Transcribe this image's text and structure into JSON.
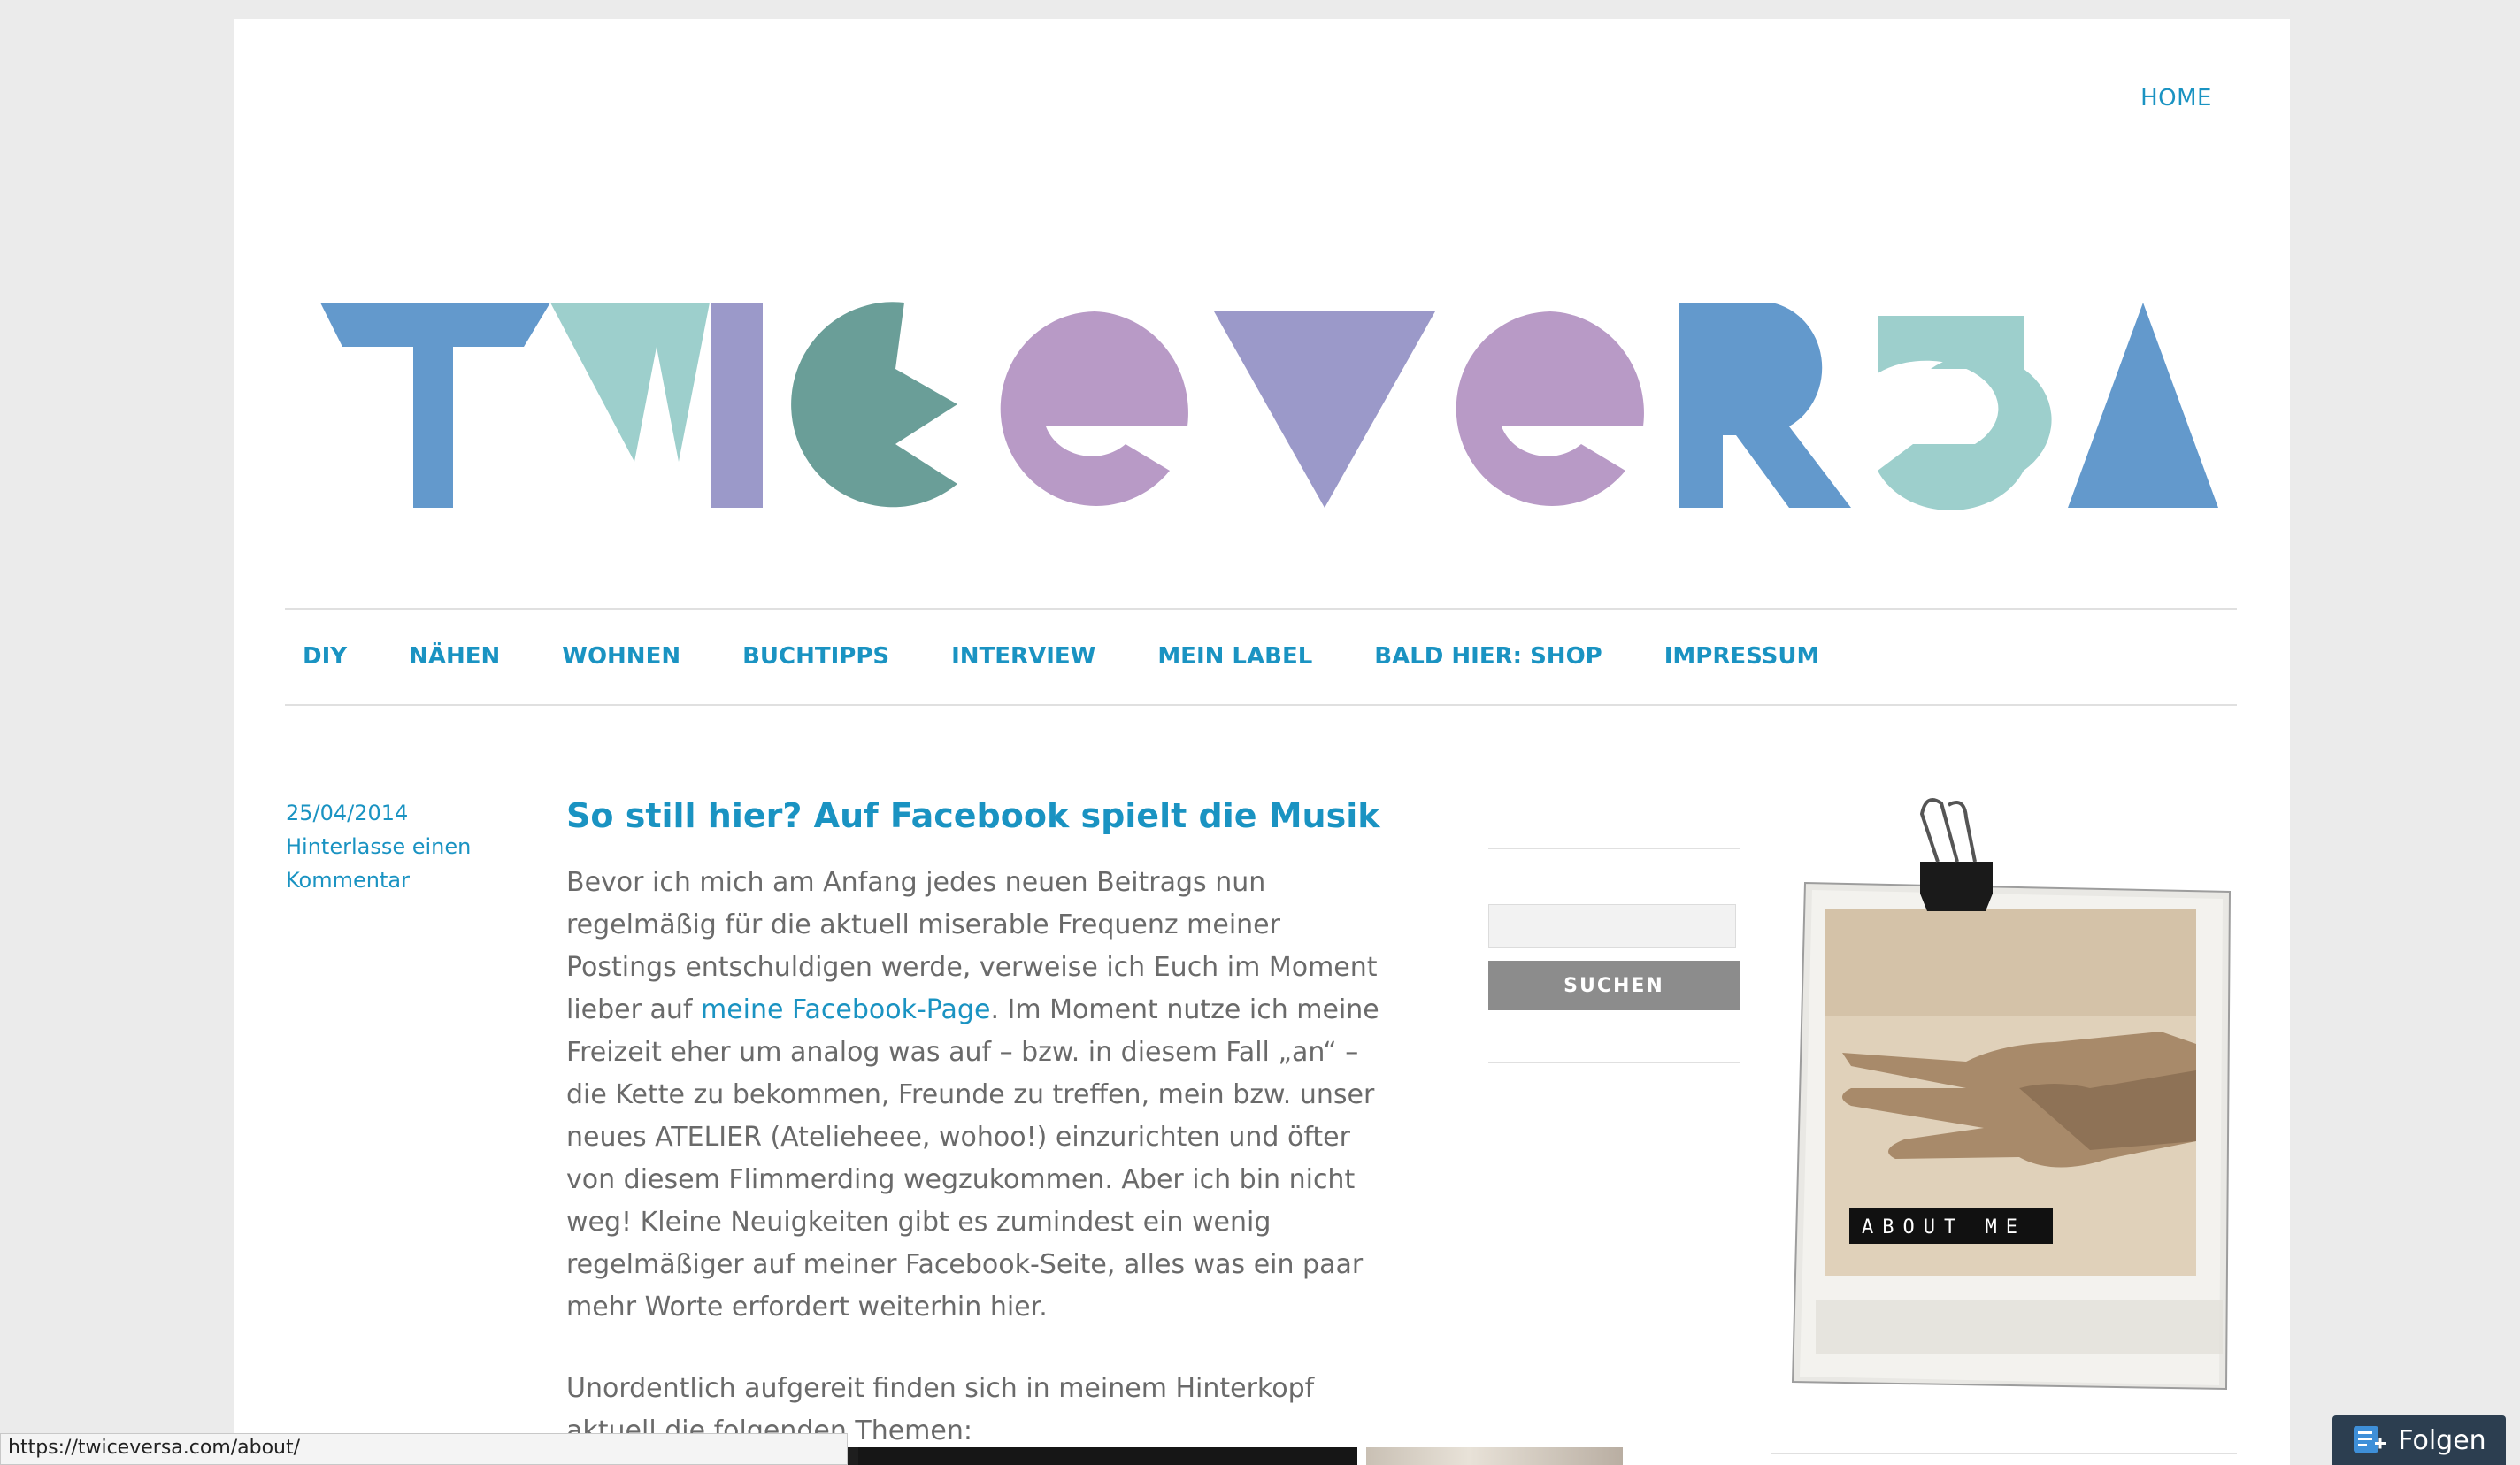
{
  "top_nav": {
    "home": "HOME"
  },
  "logo": {
    "text": "TWICEVERSA"
  },
  "main_nav": [
    "DIY",
    "NÄHEN",
    "WOHNEN",
    "BUCHTIPPS",
    "INTERVIEW",
    "MEIN LABEL",
    "BALD HIER: SHOP",
    "IMPRESSUM"
  ],
  "post": {
    "date": "25/04/2014",
    "comment_link_line1": "Hinterlasse einen",
    "comment_link_line2": "Kommentar",
    "title": "So still hier? Auf Facebook spielt die Musik",
    "p1_before": "Bevor ich mich am Anfang jedes neuen Beitrags nun regelmäßig für die aktuell miserable Frequenz meiner Postings entschuldigen werde, verweise ich Euch im Moment lieber auf ",
    "p1_link": "meine Facebook-Page",
    "p1_after": ". Im Moment nutze ich meine Freizeit eher um analog was auf – bzw. in diesem Fall „an“ – die Kette zu bekommen, Freunde zu treffen, mein bzw. unser neues ATELIER (Atelieheee, wohoo!) einzurichten und öfter von diesem Flimmerding wegzukommen. Aber ich bin nicht weg! Kleine Neuigkeiten gibt es zumindest ein wenig regelmäßiger auf meiner Facebook-Seite, alles was ein paar mehr Worte erfordert weiterhin hier.",
    "p2": "Unordentlich aufgereit finden sich in meinem Hinterkopf aktuell die folgenden Themen:"
  },
  "sidebar": {
    "search_placeholder": "",
    "search_button": "SUCHEN",
    "about_label": "ABOUT ME"
  },
  "status_bar": {
    "url": "https://twiceversa.com/about/"
  },
  "follow": {
    "label": "Folgen"
  },
  "colors": {
    "link": "#1a93c2",
    "logo_blue": "#6399cc",
    "logo_teal": "#9dcfcc",
    "logo_lavender": "#9b99c9",
    "logo_green": "#6a9e98",
    "logo_purple": "#b89ac6"
  }
}
